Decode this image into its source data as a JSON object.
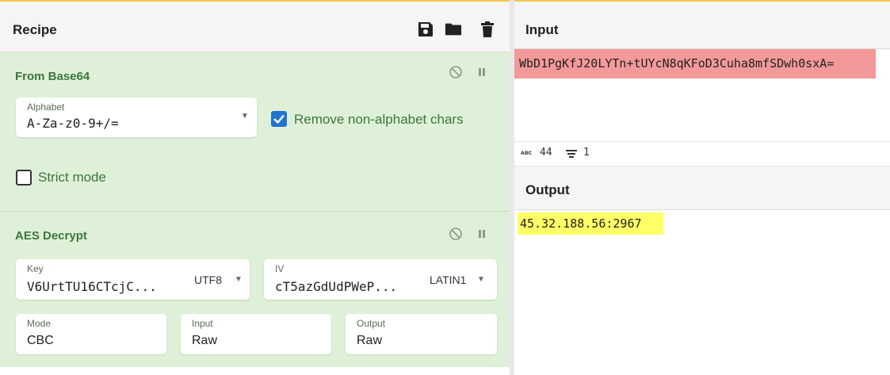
{
  "recipe": {
    "title": "Recipe",
    "header_icons": [
      "save-icon",
      "folder-icon",
      "trash-icon"
    ],
    "operations": {
      "from_base64": {
        "title": "From Base64",
        "alphabet_label": "Alphabet",
        "alphabet_value": "A-Za-z0-9+/=",
        "remove_nonalpha_label": "Remove non-alphabet chars",
        "remove_nonalpha_checked": true,
        "strict_mode_label": "Strict mode",
        "strict_mode_checked": false
      },
      "aes_decrypt": {
        "title": "AES Decrypt",
        "key_label": "Key",
        "key_value": "V6UrtTU16CTcjC...",
        "key_encoding": "UTF8",
        "iv_label": "IV",
        "iv_value": "cT5azGdUdPWeP...",
        "iv_encoding": "LATIN1",
        "mode_label": "Mode",
        "mode_value": "CBC",
        "input_label": "Input",
        "input_value": "Raw",
        "output_label": "Output",
        "output_value": "Raw"
      }
    }
  },
  "input": {
    "title": "Input",
    "text": "WbD1PgKfJ20LYTn+tUYcN8qKFoD3Cuha8mfSDwh0sxA=",
    "char_count": "44",
    "line_count": "1"
  },
  "output": {
    "title": "Output",
    "text": "45.32.188.56:2967"
  },
  "colors": {
    "op_background": "#dff0d8",
    "op_title": "#3c763d",
    "checkbox_checked": "#1f73d1",
    "input_highlight": "#f49999",
    "output_highlight": "#ffff66",
    "header_accent": "#f2c84b"
  }
}
